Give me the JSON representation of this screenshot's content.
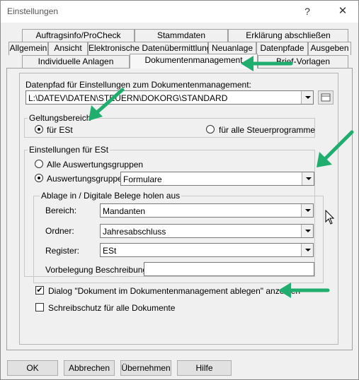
{
  "window": {
    "title": "Einstellungen",
    "help_glyph": "?",
    "close_glyph": "✕"
  },
  "tabs": {
    "row1": [
      "Auftragsinfo/ProCheck",
      "Stammdaten",
      "Erklärung abschließen"
    ],
    "row2": [
      "Allgemein",
      "Ansicht",
      "Elektronische Datenübermittlung",
      "Neuanlage",
      "Datenpfade",
      "Ausgeben"
    ],
    "row3": [
      "Individuelle Anlagen",
      "Dokumentenmanagement",
      "Brief-Vorlagen"
    ],
    "active": "Dokumentenmanagement"
  },
  "datapath": {
    "label": "Datenpfad für Einstellungen zum Dokumentenmanagement:",
    "value": "L:\\DATEV\\DATEN\\STEUERN\\DOKORG\\STANDARD"
  },
  "scope": {
    "legend": "Geltungsbereich",
    "option_est": "für ESt",
    "option_all": "für alle Steuerprogramme",
    "selected": "option_est"
  },
  "settings": {
    "legend": "Einstellungen für ESt",
    "option_all_groups": "Alle Auswertungsgruppen",
    "option_group": "Auswertungsgruppe:",
    "group_value": "Formulare",
    "selected": "option_group"
  },
  "archive": {
    "legend": "Ablage in / Digitale Belege holen aus",
    "bereich_label": "Bereich:",
    "bereich_value": "Mandanten",
    "ordner_label": "Ordner:",
    "ordner_value": "Jahresabschluss",
    "register_label": "Register:",
    "register_value": "ESt",
    "vorbelegung_label": "Vorbelegung Beschreibung:",
    "vorbelegung_value": ""
  },
  "checks": {
    "dialog_label": "Dialog \"Dokument im Dokumentenmanagement ablegen\" anzeigen",
    "dialog_checked": true,
    "readonly_label": "Schreibschutz für alle Dokumente",
    "readonly_checked": false,
    "check_glyph": "✔"
  },
  "buttons": {
    "ok": "OK",
    "cancel": "Abbrechen",
    "apply": "Übernehmen",
    "help": "Hilfe"
  },
  "colors": {
    "annotation_arrow": "#1fae6e"
  }
}
